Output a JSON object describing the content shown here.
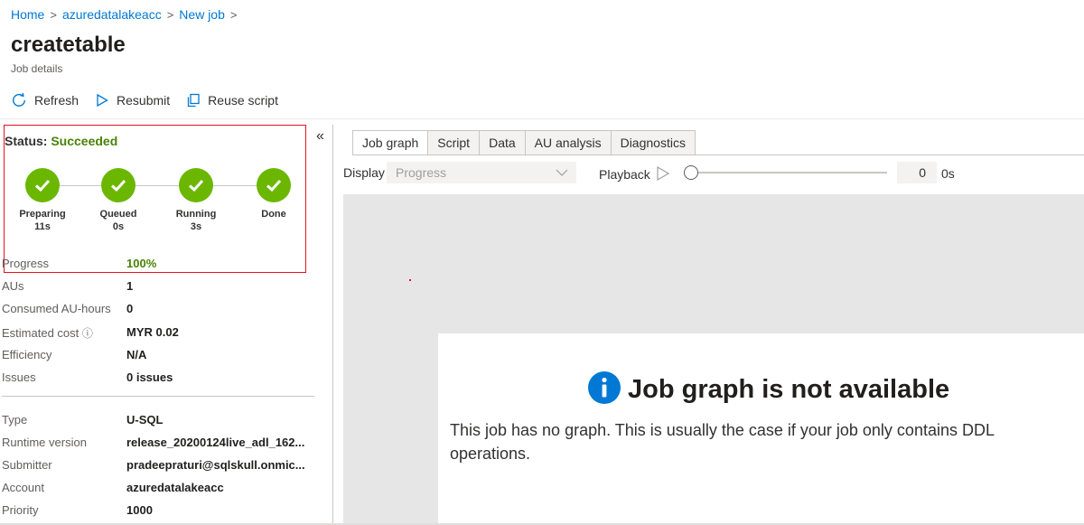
{
  "breadcrumb": [
    {
      "label": "Home"
    },
    {
      "label": "azuredatalakeacc"
    },
    {
      "label": "New job"
    }
  ],
  "breadcrumb_separator": ">",
  "page_title": "createtable",
  "page_subtitle": "Job details",
  "toolbar": {
    "refresh_label": "Refresh",
    "resubmit_label": "Resubmit",
    "reuse_label": "Reuse script"
  },
  "status": {
    "label": "Status:",
    "value": "Succeeded",
    "steps": [
      {
        "name": "Preparing",
        "time": "11s"
      },
      {
        "name": "Queued",
        "time": "0s"
      },
      {
        "name": "Running",
        "time": "3s"
      },
      {
        "name": "Done",
        "time": ""
      }
    ]
  },
  "properties": [
    {
      "key": "Progress",
      "value": "100%"
    },
    {
      "key": "AUs",
      "value": "1"
    },
    {
      "key": "Consumed AU-hours",
      "value": "0"
    },
    {
      "key": "Estimated cost",
      "value": "MYR 0.02"
    },
    {
      "key": "Efficiency",
      "value": "N/A"
    },
    {
      "key": "Issues",
      "value": "0 issues"
    }
  ],
  "details": [
    {
      "key": "Type",
      "value": "U-SQL"
    },
    {
      "key": "Runtime version",
      "value": "release_20200124live_adl_162..."
    },
    {
      "key": "Submitter",
      "value": "pradeepraturi@sqlskull.onmic..."
    },
    {
      "key": "Account",
      "value": "azuredatalakeacc"
    },
    {
      "key": "Priority",
      "value": "1000"
    }
  ],
  "collapse_glyph": "«",
  "tabs": [
    {
      "label": "Job graph"
    },
    {
      "label": "Script"
    },
    {
      "label": "Data"
    },
    {
      "label": "AU analysis"
    },
    {
      "label": "Diagnostics"
    }
  ],
  "display": {
    "label": "Display",
    "selected": "Progress"
  },
  "playback": {
    "label": "Playback",
    "value": "0",
    "unit": "0s"
  },
  "graph_message": {
    "title": "Job graph is not available",
    "body": "This job has no graph. This is usually the case if your job only contains DDL operations."
  },
  "colors": {
    "accent": "#0078d4",
    "success": "#6bb700",
    "success_text": "#498205",
    "highlight_border": "#e81123"
  }
}
